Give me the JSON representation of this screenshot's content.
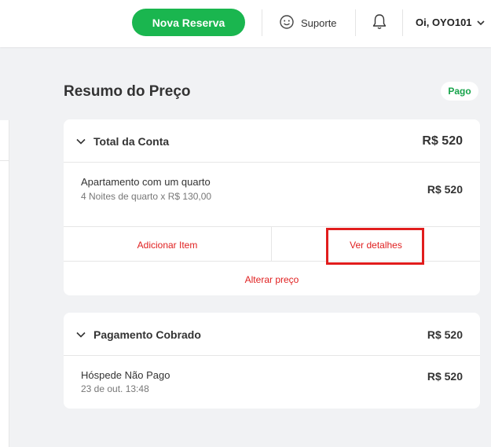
{
  "header": {
    "new_booking_label": "Nova Reserva",
    "support_label": "Suporte",
    "user_greeting": "Oi, OYO101"
  },
  "main": {
    "title": "Resumo do Preço",
    "status_badge": "Pago",
    "total_account": {
      "title": "Total da Conta",
      "amount": "R$ 520",
      "item": {
        "name": "Apartamento com um quarto",
        "detail": "4 Noites de quarto x R$ 130,00",
        "amount": "R$ 520"
      },
      "actions": {
        "add_item": "Adicionar Item",
        "view_details": "Ver detalhes",
        "change_price": "Alterar preço"
      }
    },
    "payment_charged": {
      "title": "Pagamento Cobrado",
      "amount": "R$ 520",
      "item": {
        "name": "Hóspede Não Pago",
        "detail": "23 de out. 13:48",
        "amount": "R$ 520"
      }
    }
  },
  "colors": {
    "brand_green": "#1ab64f",
    "action_red": "#e02020",
    "highlight_red": "#e11d1d"
  },
  "icons": [
    "support-icon",
    "bell-icon",
    "chevron-down-icon"
  ]
}
